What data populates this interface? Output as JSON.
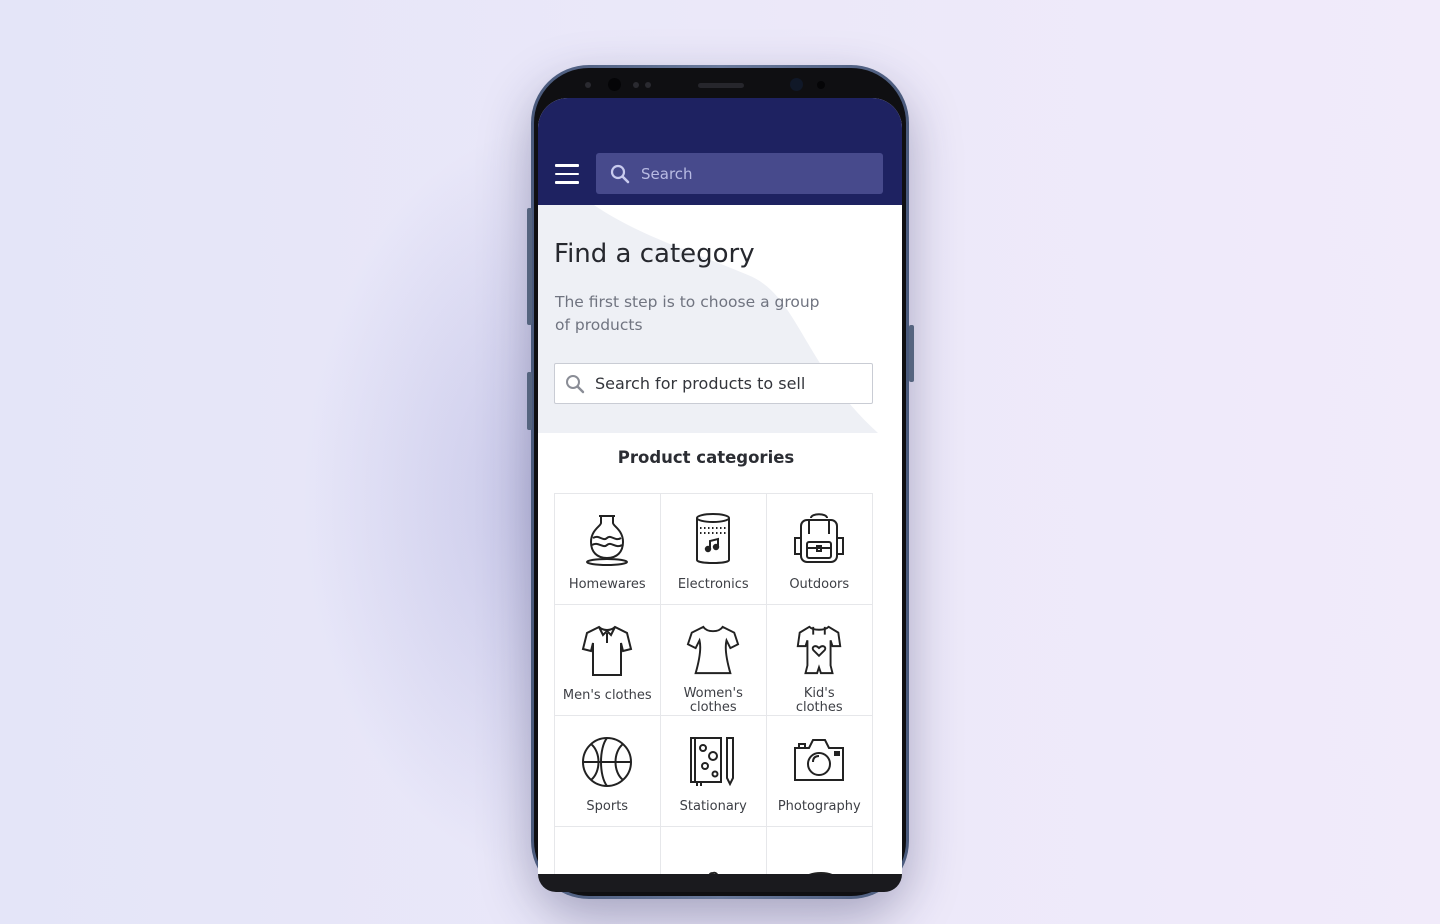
{
  "app_bar": {
    "menu_icon": "hamburger-menu-icon",
    "search_placeholder": "Search"
  },
  "hero": {
    "title": "Find a category",
    "subtitle_line1": "The first step is to choose a group",
    "subtitle_line2": "of products",
    "search_placeholder": "Search for products to sell"
  },
  "categories": {
    "title": "Product categories",
    "items": [
      {
        "label": "Homewares",
        "icon": "vase-icon"
      },
      {
        "label": "Electronics",
        "icon": "smart-speaker-icon"
      },
      {
        "label": "Outdoors",
        "icon": "backpack-icon"
      },
      {
        "label": "Men's clothes",
        "icon": "polo-shirt-icon"
      },
      {
        "label_line1": "Women's",
        "label_line2": "clothes",
        "icon": "womens-tshirt-icon"
      },
      {
        "label_line1": "Kid's",
        "label_line2": "clothes",
        "icon": "baby-romper-icon"
      },
      {
        "label": "Sports",
        "icon": "basketball-icon"
      },
      {
        "label": "Stationary",
        "icon": "notebook-pencil-icon"
      },
      {
        "label": "Photography",
        "icon": "camera-icon"
      },
      {
        "label": "",
        "icon": "plate-icon"
      },
      {
        "label": "",
        "icon": "puzzle-piece-icon"
      },
      {
        "label": "",
        "icon": "paint-palette-icon"
      }
    ]
  },
  "colors": {
    "app_bar": "#1e2261",
    "search_bar": "#474a8c",
    "hero_bg": "#eef0f5",
    "background": "#e8e7f8"
  }
}
